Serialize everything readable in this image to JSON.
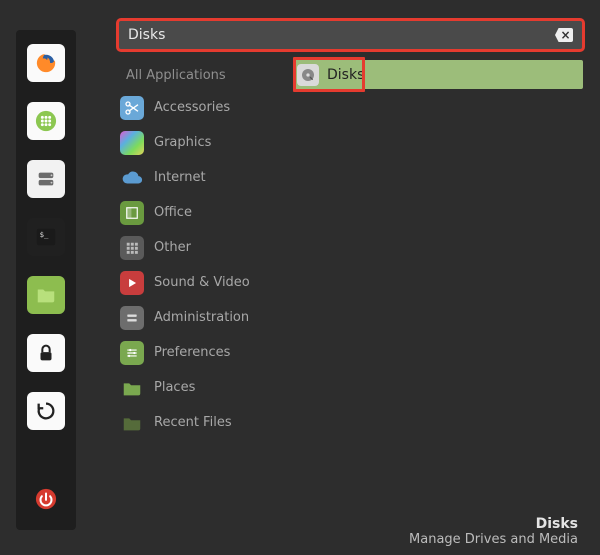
{
  "search": {
    "query": "Disks"
  },
  "dock": [
    {
      "name": "firefox"
    },
    {
      "name": "apps-grid"
    },
    {
      "name": "disks-utility"
    },
    {
      "name": "terminal"
    },
    {
      "name": "files"
    },
    {
      "name": "lock"
    },
    {
      "name": "updates"
    },
    {
      "name": "power"
    }
  ],
  "categories": {
    "header": "All Applications",
    "items": [
      {
        "label": "Accessories",
        "icon": "scissors",
        "bg": "#6aa8d8"
      },
      {
        "label": "Graphics",
        "icon": "graphics",
        "bg": "linear"
      },
      {
        "label": "Internet",
        "icon": "cloud",
        "bg": "#4d8fc4"
      },
      {
        "label": "Office",
        "icon": "office",
        "bg": "#6a9a3f"
      },
      {
        "label": "Other",
        "icon": "grid",
        "bg": "#5a5a5a"
      },
      {
        "label": "Sound & Video",
        "icon": "play",
        "bg": "#c83d3d"
      },
      {
        "label": "Administration",
        "icon": "admin",
        "bg": "#6d6d6d"
      },
      {
        "label": "Preferences",
        "icon": "prefs",
        "bg": "#7aa84f"
      },
      {
        "label": "Places",
        "icon": "folder",
        "bg": "#7aa84f"
      },
      {
        "label": "Recent Files",
        "icon": "folder-dark",
        "bg": "#556b3a"
      }
    ]
  },
  "result": {
    "label": "Disks"
  },
  "footer": {
    "title": "Disks",
    "subtitle": "Manage Drives and Media"
  },
  "annotations": {
    "highlight_color": "#e53b2f"
  }
}
